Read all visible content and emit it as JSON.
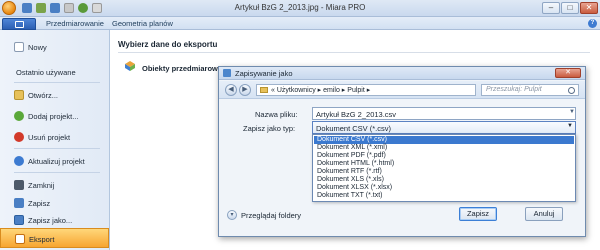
{
  "window": {
    "title": "Artykuł BzG 2_2013.jpg - Miara PRO",
    "min": "–",
    "max": "□",
    "close": "✕"
  },
  "ribbon": {
    "tabs": [
      "Przedmiarowanie",
      "Geometria planów"
    ],
    "help": "?"
  },
  "sidebar": {
    "new": "Nowy",
    "recent": "Ostatnio używane",
    "open": "Otwórz...",
    "add_project": "Dodaj projekt...",
    "remove_project": "Usuń projekt",
    "update_project": "Aktualizuj projekt",
    "close": "Zamknij",
    "save": "Zapisz",
    "save_as": "Zapisz jako...",
    "export": "Eksport"
  },
  "content": {
    "title": "Wybierz dane do eksportu",
    "objects_label": "Obiekty przedmiarowe"
  },
  "dialog": {
    "title": "Zapisywanie jako",
    "close": "✕",
    "nav": {
      "back": "◀",
      "forward": "▶",
      "path": "« Użytkownicy ▸ emilo ▸ Pulpit ▸",
      "path_drop": "▾",
      "refresh": "↻",
      "search_placeholder": "Przeszukaj: Pulpit"
    },
    "filename_label": "Nazwa pliku:",
    "filename_value": "Artykuł BzG 2_2013.csv",
    "filetype_label": "Zapisz jako typ:",
    "filetype_selected": "Dokument CSV (*.csv)",
    "filetype_options": [
      "Dokument CSV (*.csv)",
      "Dokument XML (*.xml)",
      "Dokument PDF (*.pdf)",
      "Dokument HTML (*.html)",
      "Dokument RTF (*.rtf)",
      "Dokument XLS (*.xls)",
      "Dokument XLSX (*.xlsx)",
      "Dokument TXT (*.txt)"
    ],
    "selected_index": 0,
    "browse_folders": "Przeglądaj foldery",
    "save_button": "Zapisz",
    "cancel_button": "Anuluj"
  },
  "colors": {
    "accent": "#3b79cf",
    "active_item": "#f7a531"
  }
}
